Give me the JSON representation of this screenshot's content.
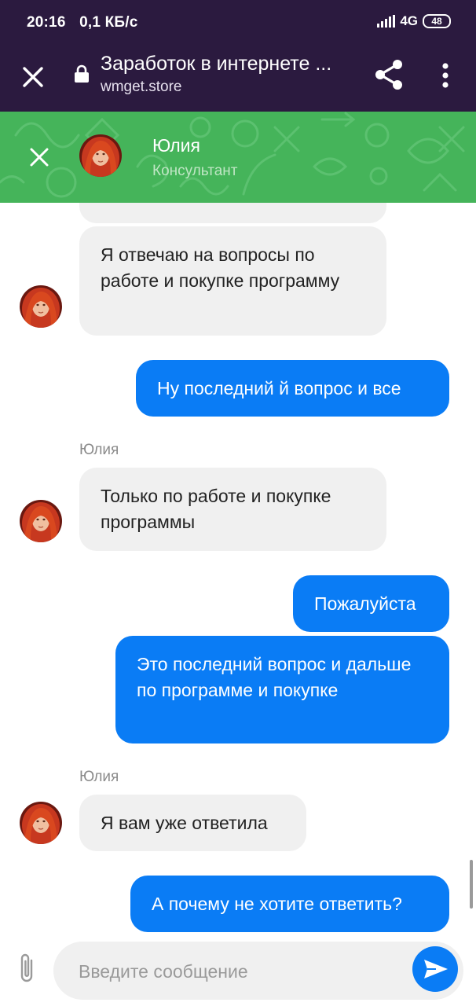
{
  "status_bar": {
    "time": "20:16",
    "speed": "0,1 КБ/с",
    "network": "4G",
    "battery": "48"
  },
  "browser": {
    "title": "Заработок в интернете ...",
    "url": "wmget.store"
  },
  "chat_header": {
    "name": "Юлия",
    "role": "Консультант"
  },
  "messages": [
    {
      "side": "in",
      "text": "Я отвечаю на вопросы по работе и покупке программу"
    },
    {
      "side": "out",
      "text": "Ну последний й вопрос и все"
    },
    {
      "side": "in",
      "sender": "Юлия",
      "text": "Только по работе и покупке программы"
    },
    {
      "side": "out",
      "text": "Пожалуйста"
    },
    {
      "side": "out",
      "text": "Это последний вопрос и дальше по программе и покупке"
    },
    {
      "side": "in",
      "sender": "Юлия",
      "text": "Я вам уже ответила"
    },
    {
      "side": "out",
      "text": "А почему не хотите ответить?"
    }
  ],
  "composer": {
    "placeholder": "Введите сообщение"
  },
  "icons": {
    "browser_close": "close-icon",
    "lock": "lock-icon",
    "share": "share-icon",
    "menu": "more-vertical-icon",
    "chat_close": "close-icon",
    "attach": "paperclip-icon",
    "send": "send-icon"
  },
  "colors": {
    "status_bg": "#2b1a3f",
    "header_green": "#45b45a",
    "outgoing_bubble": "#0a7cf5",
    "incoming_bubble": "#f0f0f0"
  }
}
